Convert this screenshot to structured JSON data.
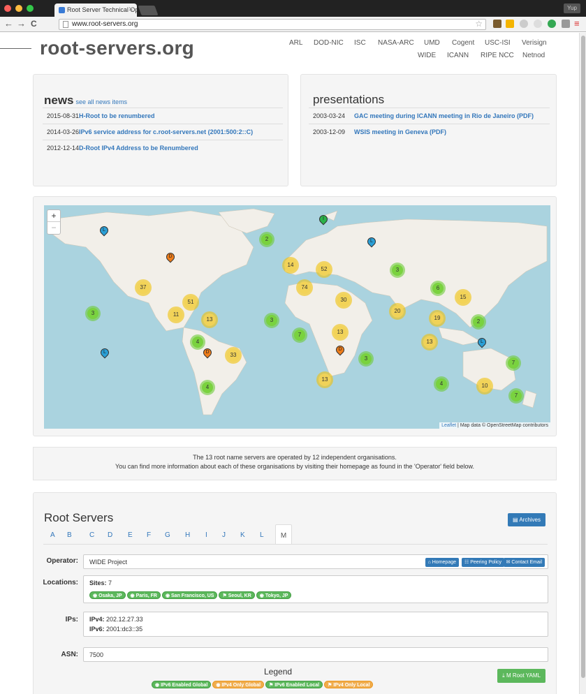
{
  "browser": {
    "tab_title": "Root Server Technical Op...",
    "url": "www.root-servers.org",
    "user_label": "Yup"
  },
  "site": {
    "logo": "root-servers.org",
    "operators_row1": [
      "ARL",
      "DOD-NIC",
      "ISC",
      "NASA-ARC",
      "UMD",
      "Cogent",
      "USC-ISI",
      "Verisign"
    ],
    "operators_row2": [
      "WIDE",
      "ICANN",
      "RIPE NCC",
      "Netnod"
    ]
  },
  "news": {
    "title": "news",
    "link": "see all news items",
    "items": [
      {
        "date": "2015-08-31",
        "text": "H-Root to be renumbered"
      },
      {
        "date": "2014-03-26",
        "text": "IPv6 service address for c.root-servers.net (2001:500:2::C)"
      },
      {
        "date": "2012-12-14",
        "text": "D-Root IPv4 Address to be Renumbered"
      }
    ]
  },
  "presentations": {
    "title": "presentations",
    "items": [
      {
        "date": "2003-03-24",
        "text": "GAC meeting during ICANN meeting in Rio de Janeiro (PDF)"
      },
      {
        "date": "2003-12-09",
        "text": "WSIS meeting in Geneva (PDF)"
      }
    ]
  },
  "map": {
    "zoom_in": "+",
    "zoom_out": "−",
    "attribution_link": "Leaflet",
    "attribution_text": " | Map data © OpenStreetMap contributors",
    "clusters": [
      "2",
      "14",
      "52",
      "3",
      "37",
      "74",
      "6",
      "15",
      "30",
      "51",
      "20",
      "3",
      "11",
      "13",
      "3",
      "19",
      "2",
      "7",
      "13",
      "13",
      "4",
      "33",
      "3",
      "7",
      "4",
      "13",
      "4",
      "10",
      "7"
    ],
    "pins": [
      "L",
      "I",
      "D",
      "L",
      "L",
      "D",
      "L",
      "D"
    ]
  },
  "info": {
    "line1": "The 13 root name servers are operated by 12 independent organisations.",
    "line2": "You can find more information about each of these organisations by visiting their homepage as found in the 'Operator' field below."
  },
  "root_servers": {
    "title": "Root Servers",
    "archives": "Archives",
    "letters": [
      "A",
      "B",
      "C",
      "D",
      "E",
      "F",
      "G",
      "H",
      "I",
      "J",
      "K",
      "L",
      "M"
    ],
    "operator_label": "Operator:",
    "operator": "WIDE Project",
    "homepage": "Homepage",
    "peering": "Peering Policy",
    "contact": "Contact Email",
    "locations_label": "Locations:",
    "sites_label": "Sites:",
    "sites_count": "7",
    "sites": [
      "Osaka, JP",
      "Paris, FR",
      "San Francisco, US",
      "Seoul, KR",
      "Tokyo, JP"
    ],
    "ips_label": "IPs:",
    "ipv4_label": "IPv4:",
    "ipv4": "202.12.27.33",
    "ipv6_label": "IPv6:",
    "ipv6": "2001:dc3::35",
    "asn_label": "ASN:",
    "asn": "7500",
    "legend": "Legend",
    "yaml": "M Root YAML",
    "legend_items": [
      "IPv6 Enabled Global",
      "IPv4 Only Global",
      "IPv6 Enabled Local",
      "IPv4 Only Local"
    ]
  }
}
